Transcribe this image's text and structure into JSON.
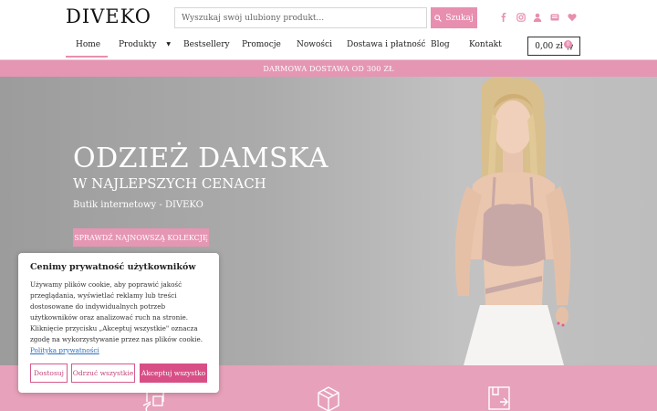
{
  "header": {
    "logo": "DIVEKO",
    "search_placeholder": "Wyszukaj swój ulubiony produkt...",
    "search_button": "Szukaj",
    "social_icons": [
      "facebook-icon",
      "instagram-icon",
      "user-icon",
      "newsletter-icon",
      "heart-icon"
    ]
  },
  "nav": {
    "items": [
      "Home",
      "Produkty",
      "Bestsellery",
      "Promocje",
      "Nowości",
      "Dostawa i płatność",
      "Blog",
      "Kontakt"
    ],
    "active": "Home",
    "cart_total": "0,00 zł",
    "cart_count": "0"
  },
  "promo": {
    "text": "DARMOWA DOSTAWA OD 300 ZŁ"
  },
  "hero": {
    "title": "ODZIEŻ DAMSKA",
    "subtitle": "W NAJLEPSZYCH CENACH",
    "tagline": "Butik internetowy - DIVEKO",
    "cta": "SPRAWDŹ NAJNOWSZĄ KOLEKCJĘ"
  },
  "cookie": {
    "title": "Cenimy prywatność użytkowników",
    "text": "Używamy plików cookie, aby poprawić jakość przeglądania, wyświetlać reklamy lub treści dostosowane do indywidualnych potrzeb użytkowników oraz analizować ruch na stronie. Kliknięcie przycisku „Akceptuj wszystkie\" oznacza zgodę na wykorzystywanie przez nas plików cookie.",
    "link": "Polityka prywatności",
    "buttons": {
      "customize": "Dostosuj",
      "reject": "Odrzuć wszystkie",
      "accept": "Akceptuj wszystko"
    }
  },
  "colors": {
    "accent": "#e88fb0",
    "accent_dark": "#d84f86",
    "promo_bg": "#e596b3"
  }
}
